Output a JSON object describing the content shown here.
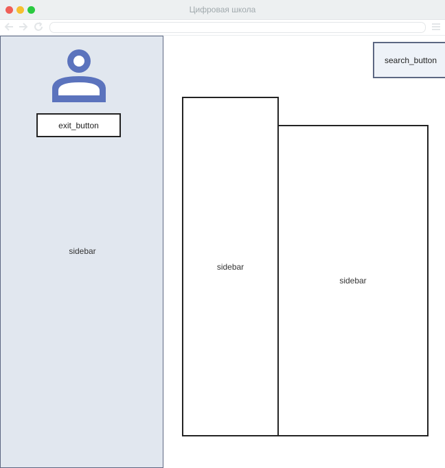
{
  "window": {
    "title": "Цифровая школа"
  },
  "sidebar_left": {
    "label": "sidebar",
    "exit_button_label": "exit_button"
  },
  "header": {
    "search_button_label": "search_button"
  },
  "main": {
    "panel_a_label": "sidebar",
    "panel_b_label": "sidebar"
  },
  "colors": {
    "sidebar_bg": "#e1e7ef",
    "accent": "#5b73bd",
    "border": "#5c6782"
  }
}
